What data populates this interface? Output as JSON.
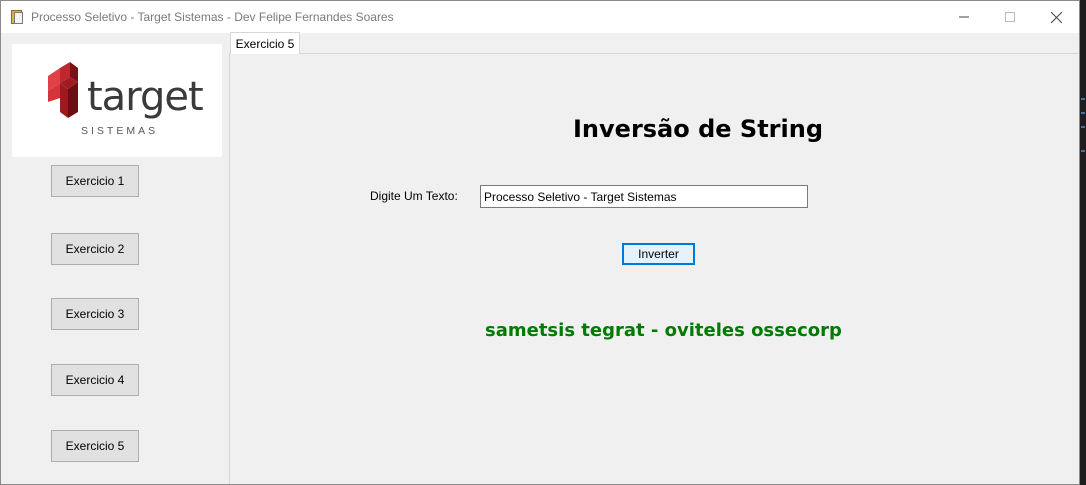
{
  "window": {
    "title": "Processo Seletivo - Target Sistemas - Dev Felipe Fernandes Soares"
  },
  "logo": {
    "brand": "target",
    "subtitle": "SISTEMAS",
    "colors": {
      "mark": "#c0262d",
      "text": "#3a3a3a"
    }
  },
  "sidebar": {
    "buttons": [
      "Exercicio 1",
      "Exercicio 2",
      "Exercicio 3",
      "Exercicio 4",
      "Exercicio 5"
    ]
  },
  "tabs": [
    {
      "label": "Exercicio 5",
      "selected": true
    }
  ],
  "main": {
    "heading": "Inversão de String",
    "input_label": "Digite Um Texto:",
    "input_value": "Processo Seletivo - Target Sistemas",
    "button_label": "Inverter",
    "result": "sametsis tegrat - oviteles ossecorp"
  },
  "colors": {
    "result": "#007a00",
    "focus_border": "#0078d7"
  }
}
